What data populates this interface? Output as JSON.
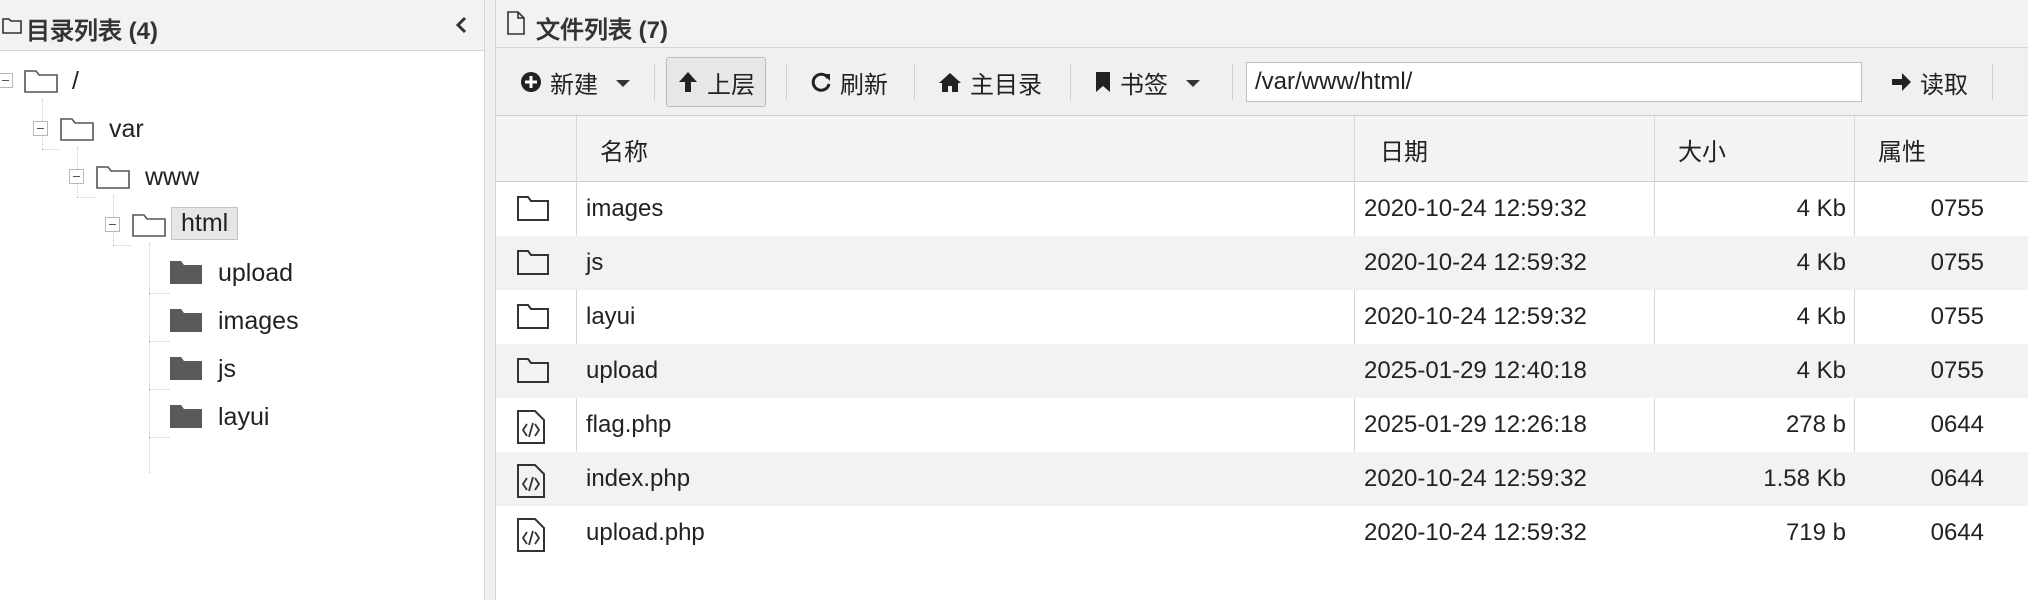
{
  "left_panel": {
    "title": "目录列表 (4)",
    "tree": {
      "root": "/",
      "var": "var",
      "www": "www",
      "html": "html",
      "children": [
        "upload",
        "images",
        "js",
        "layui"
      ]
    }
  },
  "right_panel": {
    "title": "文件列表 (7)",
    "toolbar": {
      "new_label": "新建",
      "up_label": "上层",
      "refresh_label": "刷新",
      "home_label": "主目录",
      "bookmark_label": "书签",
      "path_value": "/var/www/html/",
      "read_label": "读取"
    },
    "columns": {
      "name": "名称",
      "date": "日期",
      "size": "大小",
      "attr": "属性"
    },
    "files": [
      {
        "name": "images",
        "date": "2020-10-24 12:59:32",
        "size": "4 Kb",
        "attr": "0755",
        "icon": "folder-icon"
      },
      {
        "name": "js",
        "date": "2020-10-24 12:59:32",
        "size": "4 Kb",
        "attr": "0755",
        "icon": "folder-icon"
      },
      {
        "name": "layui",
        "date": "2020-10-24 12:59:32",
        "size": "4 Kb",
        "attr": "0755",
        "icon": "folder-icon"
      },
      {
        "name": "upload",
        "date": "2025-01-29 12:40:18",
        "size": "4 Kb",
        "attr": "0755",
        "icon": "folder-icon"
      },
      {
        "name": "flag.php",
        "date": "2025-01-29 12:26:18",
        "size": "278 b",
        "attr": "0644",
        "icon": "code-file-icon"
      },
      {
        "name": "index.php",
        "date": "2020-10-24 12:59:32",
        "size": "1.58 Kb",
        "attr": "0644",
        "icon": "code-file-icon"
      },
      {
        "name": "upload.php",
        "date": "2020-10-24 12:59:32",
        "size": "719 b",
        "attr": "0644",
        "icon": "code-file-icon"
      }
    ]
  },
  "colors": {
    "header_bg": "#f2f2f2",
    "stripe_bg": "#f2f2f2",
    "folder_fill": "#5a5a5a"
  }
}
